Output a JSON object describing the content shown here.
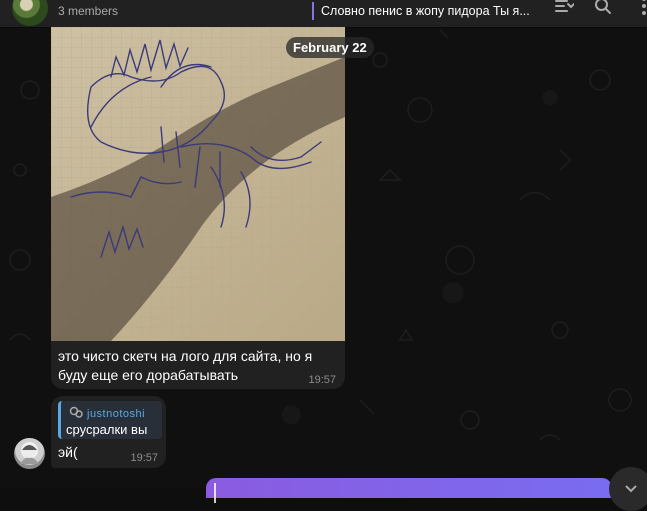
{
  "header": {
    "members_text": "3 members",
    "pinned_message": "Словно пенис в жопу пидора Ты я...",
    "icons": [
      "chat-group-avatar",
      "pinned-list-icon",
      "search-icon",
      "more-vertical-icon"
    ]
  },
  "chat": {
    "date_label": "February 22",
    "photo_message": {
      "caption": "это чисто скетч на лого для сайта, но я буду еще его дорабатывать",
      "time": "19:57"
    },
    "reply_message": {
      "reply_sender": "justnotoshi",
      "reply_text": "срусралки вы",
      "text": "эй(",
      "time": "19:57"
    }
  },
  "colors": {
    "accent": "#8774e1",
    "reply_accent": "#5aa9e6",
    "bubble": "#212121",
    "header": "#212121"
  }
}
